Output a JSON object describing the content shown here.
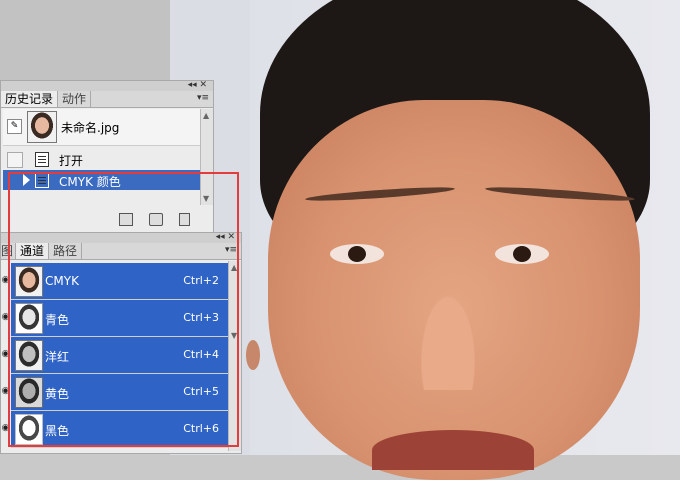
{
  "history_panel": {
    "tabs": [
      {
        "label": "历史记录",
        "active": true
      },
      {
        "label": "动作",
        "active": false
      }
    ],
    "snapshot": {
      "name": "未命名.jpg"
    },
    "steps": [
      {
        "label": "打开",
        "selected": false
      },
      {
        "label": "CMYK 颜色",
        "selected": true
      }
    ],
    "footer_icons": [
      "new-document-icon",
      "camera-icon",
      "trash-icon"
    ]
  },
  "channels_panel": {
    "tabs": [
      {
        "label": "图层",
        "active": false
      },
      {
        "label": "通道",
        "active": true
      },
      {
        "label": "路径",
        "active": false
      }
    ],
    "channels": [
      {
        "name": "CMYK",
        "shortcut": "Ctrl+2"
      },
      {
        "name": "青色",
        "shortcut": "Ctrl+3"
      },
      {
        "name": "洋红",
        "shortcut": "Ctrl+4"
      },
      {
        "name": "黄色",
        "shortcut": "Ctrl+5"
      },
      {
        "name": "黑色",
        "shortcut": "Ctrl+6"
      }
    ]
  },
  "colors": {
    "selection": "#2f63c6",
    "highlight_box": "#e23c3c"
  }
}
